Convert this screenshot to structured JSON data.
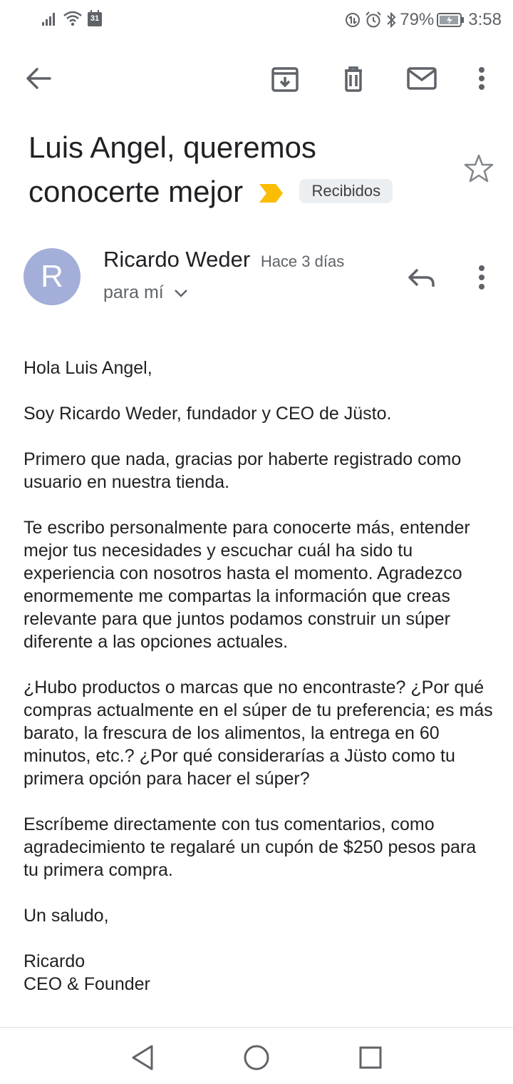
{
  "status_bar": {
    "calendar_day": "31",
    "battery": "79%",
    "time": "3:58",
    "icons": [
      "signal-icon",
      "wifi-icon",
      "calendar-icon",
      "data-saver-icon",
      "alarm-icon",
      "bluetooth-icon",
      "battery-icon"
    ]
  },
  "toolbar": {
    "icons": [
      "back-arrow-icon",
      "archive-icon",
      "trash-icon",
      "mail-icon",
      "more-vert-icon"
    ]
  },
  "email": {
    "subject_line1": "Luis Angel, queremos",
    "subject_line2": "conocerte mejor",
    "label": "Recibidos",
    "label_color": "#fbbc04",
    "sender_initial": "R",
    "avatar_color": "#a3aed9",
    "sender_name": "Ricardo Weder",
    "time": "Hace 3 días",
    "recipient": "para mí",
    "body": [
      "Hola Luis Angel,",
      "Soy Ricardo Weder, fundador y CEO de Jüsto.",
      "Primero que nada, gracias por haberte registrado como usuario en nuestra tienda.",
      "Te escribo personalmente para conocerte más, entender mejor tus necesidades y escuchar cuál ha sido tu experiencia con nosotros hasta el momento. Agradezco enormemente me compartas la información que creas relevante para que juntos podamos construir un súper diferente a las opciones actuales.",
      "¿Hubo productos o marcas que no encontraste? ¿Por qué compras actualmente en el súper de tu preferencia; es más barato, la frescura de los alimentos, la entrega en 60 minutos, etc.? ¿Por qué considerarías a Jüsto como tu primera opción para hacer el súper?",
      "Escríbeme directamente con tus comentarios, como agradecimiento te regalaré un cupón de $250 pesos para tu primera compra.",
      "Un saludo,",
      "Ricardo",
      "CEO & Founder"
    ]
  },
  "nav_bar": {
    "icons": [
      "nav-back-icon",
      "nav-home-icon",
      "nav-recents-icon"
    ]
  }
}
